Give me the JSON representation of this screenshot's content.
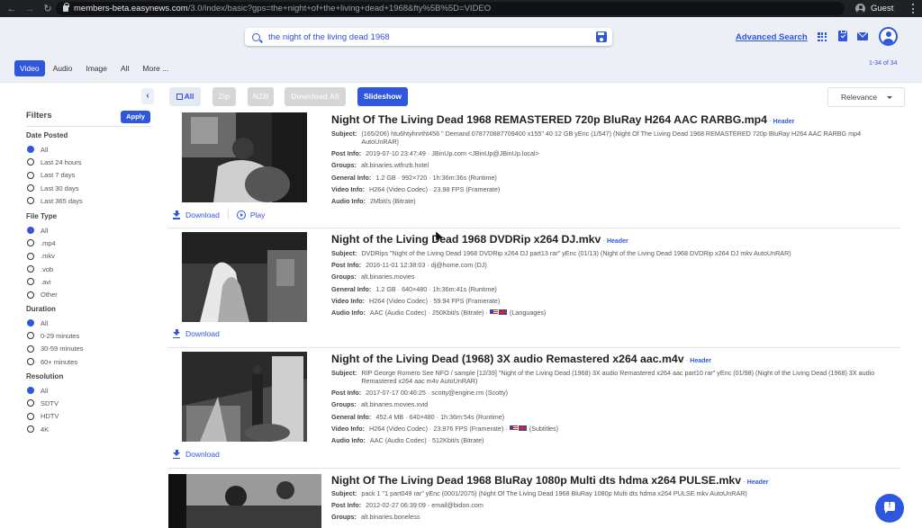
{
  "browser": {
    "url_host": "members-beta.easynews.com",
    "url_path": "/3.0/index/basic?gps=the+night+of+the+living+dead+1968&fty%5B%5D=VIDEO",
    "profile_label": "Guest"
  },
  "header": {
    "search_value": "the night of the living dead 1968",
    "advanced_search_label": "Advanced Search",
    "result_count": "1-34 of 34",
    "icons": [
      "grid-icon",
      "clipboard-check-icon",
      "mail-icon",
      "account-icon"
    ]
  },
  "tabs": [
    {
      "label": "Video",
      "active": true
    },
    {
      "label": "Audio",
      "active": false
    },
    {
      "label": "Image",
      "active": false
    },
    {
      "label": "All",
      "active": false
    },
    {
      "label": "More ...",
      "active": false
    }
  ],
  "toolbar": {
    "select_all_label": "All",
    "zip_label": "Zip",
    "nzb_label": "NZB",
    "download_all_label": "Download All",
    "slideshow_label": "Slideshow",
    "sort_value": "Relevance"
  },
  "filters": {
    "title": "Filters",
    "apply_label": "Apply",
    "groups": [
      {
        "title": "Date Posted",
        "options": [
          "All",
          "Last 24 hours",
          "Last 7 days",
          "Last 30 days",
          "Last 365 days"
        ],
        "selected": "All"
      },
      {
        "title": "File Type",
        "options": [
          "All",
          ".mp4",
          ".mkv",
          ".vob",
          ".avi",
          "Other"
        ],
        "selected": "All"
      },
      {
        "title": "Duration",
        "options": [
          "All",
          "0-29 minutes",
          "30-59 minutes",
          "60+ minutes"
        ],
        "selected": "All"
      },
      {
        "title": "Resolution",
        "options": [
          "All",
          "SDTV",
          "HDTV",
          "4K"
        ],
        "selected": "All"
      }
    ]
  },
  "labels": {
    "header_link": "Header",
    "subject": "Subject:",
    "post_info": "Post Info:",
    "groups": "Groups:",
    "general_info": "General Info:",
    "video_info": "Video Info:",
    "audio_info": "Audio Info:",
    "download": "Download",
    "play": "Play"
  },
  "results": [
    {
      "title": "Night Of The Living Dead 1968 REMASTERED 720p BluRay H264 AAC RARBG.mp4",
      "subject": "(165/206) htu6htyhnrtht456 \" Demand 078770887709400 x155\" 40 12 GB yEnc (1/547) (Night Of The Living Dead 1968 REMASTERED 720p BluRay H264 AAC RARBG mp4 AutoUnRAR)",
      "post_info": "2019-07-10 23:47:49 · JBinUp.com <JBinUp@JBinUp.local>",
      "groups": "alt.binaries.wtfnzb.hotel",
      "general_info": "1.2 GB · 992×720 · 1h:36m:36s (Runtime)",
      "video_info": "H264 (Video Codec) · 23.98 FPS (Framerate)",
      "video_extra": "",
      "audio_info": "2Mbit/s (Bitrate)",
      "audio_extra": "",
      "has_play": true
    },
    {
      "title": "Night of the Living Dead 1968 DVDRip x264 DJ.mkv",
      "subject": "DVDRips \"Night of the Living Dead 1968 DVDRip x264 DJ part13 rar\" yEnc (01/13) (Night of the Living Dead 1968 DVDRip x264 DJ mkv AutoUnRAR)",
      "post_info": "2016-11-01 12:38:03 · dj@home.com (DJ)",
      "groups": "alt.binaries.movies",
      "general_info": "1.2 GB · 640×480 · 1h:36m:41s (Runtime)",
      "video_info": "H264 (Video Codec) · 59.94 FPS (Framerate)",
      "video_extra": "",
      "audio_info": "AAC (Audio Codec) · 250Kbit/s (Bitrate) ·",
      "audio_extra": "(Languages)",
      "has_play": false
    },
    {
      "title": "Night of the Living Dead (1968) 3X audio Remastered x264 aac.m4v",
      "subject": "RIP George Romero See NFO / sample [12/39] \"Night of the Living Dead (1968) 3X audio Remastered x264 aac part10 rar\" yEnc (01/98) (Night of the Living Dead (1968) 3X audio Remastered x264 aac m4v AutoUnRAR)",
      "post_info": "2017-07-17 00:46:25 · scotty@engine.rm (Scotty)",
      "groups": "alt.binaries.movies.xvid",
      "general_info": "452.4 MB · 640×480 · 1h:36m:54s (Runtime)",
      "video_info": "H264 (Video Codec) · 23.976 FPS (Framerate) ·",
      "video_extra": "(Subtitles)",
      "audio_info": "AAC (Audio Codec) · 512Kbit/s (Bitrate)",
      "audio_extra": "",
      "has_play": false
    },
    {
      "title": "Night Of The Living Dead 1968 BluRay 1080p Multi dts hdma x264 PULSE.mkv",
      "subject": "pack 1 \"1 part049 rar\" yEnc (0001/2075) (Night Of The Living Dead 1968 BluRay 1080p Multi dts hdma x264 PULSE mkv AutoUnRAR)",
      "post_info": "2012-02-27 06:39:09 · email@bidon.com",
      "groups": "alt.binaries.boneless"
    }
  ]
}
